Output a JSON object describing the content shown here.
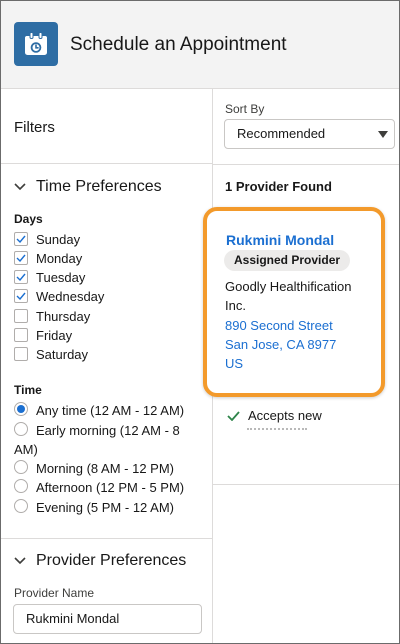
{
  "header": {
    "title": "Schedule an Appointment",
    "icon": "calendar-icon"
  },
  "filters": {
    "title": "Filters"
  },
  "time_preferences": {
    "title": "Time Preferences",
    "days_label": "Days",
    "days": [
      {
        "label": "Sunday",
        "checked": true
      },
      {
        "label": "Monday",
        "checked": true
      },
      {
        "label": "Tuesday",
        "checked": true
      },
      {
        "label": "Wednesday",
        "checked": true
      },
      {
        "label": "Thursday",
        "checked": false
      },
      {
        "label": "Friday",
        "checked": false
      },
      {
        "label": "Saturday",
        "checked": false
      }
    ],
    "time_label": "Time",
    "times": [
      {
        "label": "Any time (12 AM - 12 AM)",
        "selected": true
      },
      {
        "label": "Early morning (12 AM - 8 AM)",
        "selected": false
      },
      {
        "label": "Morning (8 AM - 12 PM)",
        "selected": false
      },
      {
        "label": "Afternoon (12 PM - 5 PM)",
        "selected": false
      },
      {
        "label": "Evening (5 PM - 12 AM)",
        "selected": false
      }
    ]
  },
  "provider_preferences": {
    "title": "Provider Preferences",
    "name_label": "Provider Name",
    "name_value": "Rukmini Mondal"
  },
  "results": {
    "sort_label": "Sort By",
    "sort_value": "Recommended",
    "found": "1 Provider Found",
    "provider": {
      "name": "Rukmini Mondal",
      "badge": "Assigned Provider",
      "org": "Goodly Healthification Inc.",
      "address_line1": "890 Second Street",
      "address_line2": "San Jose, CA 8977",
      "address_line3": "US",
      "accepts": "Accepts new"
    }
  },
  "colors": {
    "accent": "#1b6fd1",
    "highlight": "#f39a2b",
    "success": "#2e844a"
  }
}
